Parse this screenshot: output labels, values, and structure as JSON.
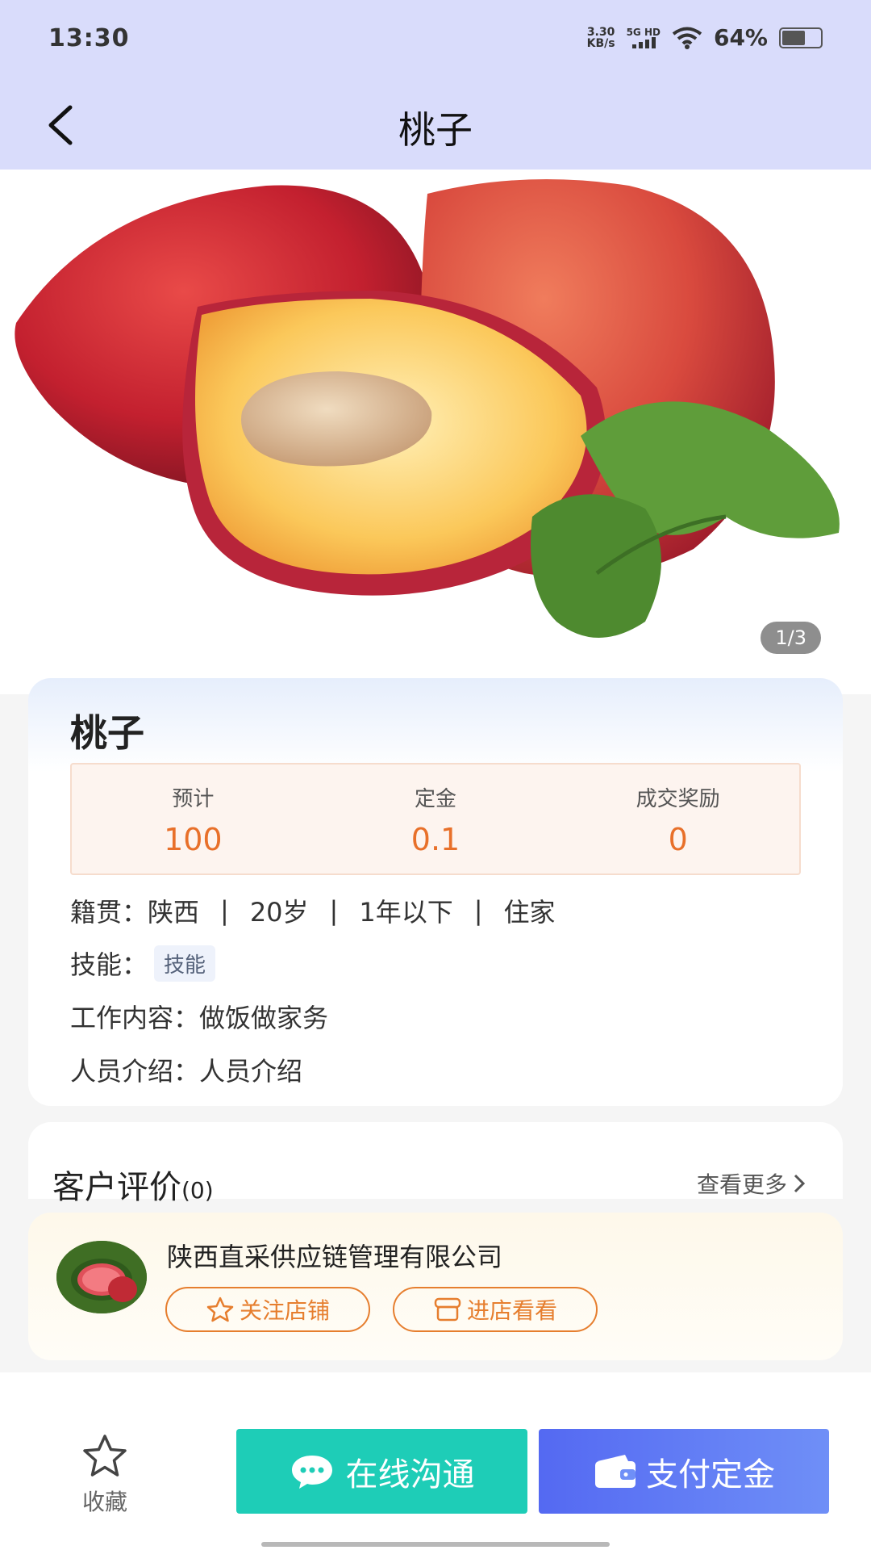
{
  "status_bar": {
    "time": "13:30",
    "net_speed_value": "3.30",
    "net_speed_unit": "KB/s",
    "network": "5G HD",
    "battery": "64%",
    "battery_level": 0.64,
    "icons": [
      "wifi-icon",
      "signal-icon",
      "battery-icon"
    ]
  },
  "nav": {
    "title": "桃子",
    "back_icon": "chevron-left-icon"
  },
  "gallery": {
    "counter": "1/3",
    "image": "peach-photo"
  },
  "product": {
    "title": "桃子",
    "stats": [
      {
        "label": "预计",
        "value": "100"
      },
      {
        "label": "定金",
        "value": "0.1"
      },
      {
        "label": "成交奖励",
        "value": "0"
      }
    ],
    "origin_label": "籍贯：",
    "origin": "陕西",
    "sep": "|",
    "age": "20岁",
    "experience": "1年以下",
    "living": "住家",
    "skills_label": "技能：",
    "skill_tag": "技能",
    "work_label": "工作内容：",
    "work": "做饭做家务",
    "intro_label": "人员介绍：",
    "intro": "人员介绍"
  },
  "reviews": {
    "title": "客户评价",
    "count": "(0)",
    "more": "查看更多"
  },
  "shop": {
    "name": "陕西直采供应链管理有限公司",
    "follow_label": "关注店铺",
    "visit_label": "进店看看",
    "accent": "#e67e2e"
  },
  "bottom": {
    "fav_label": "收藏",
    "chat_label": "在线沟通",
    "pay_label": "支付定金",
    "chat_color": "#1ecdb7",
    "pay_color": "#5469f2"
  }
}
